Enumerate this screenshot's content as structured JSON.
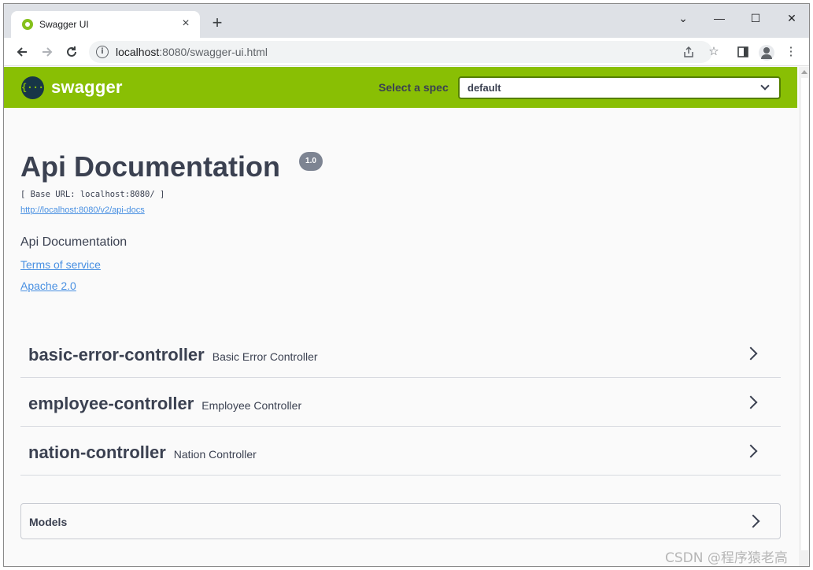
{
  "browser": {
    "tab_title": "Swagger UI",
    "tab_close": "×",
    "new_tab": "+",
    "window_controls": {
      "chevron": "⌄",
      "minimize": "—",
      "maximize": "☐",
      "close": "✕"
    },
    "url_host": "localhost",
    "url_path": ":8080/swagger-ui.html",
    "icons": [
      "back-icon",
      "forward-icon",
      "reload-icon",
      "site-info-icon",
      "share-icon",
      "bookmark-star-icon",
      "side-panel-icon",
      "profile-icon",
      "menu-icon"
    ]
  },
  "topbar": {
    "logo_text": "swagger",
    "logo_mark": "{···}",
    "select_label": "Select a spec",
    "select_value": "default",
    "accent_color": "#89bf04"
  },
  "info": {
    "title": "Api Documentation",
    "version": "1.0",
    "base_url": "[ Base URL: localhost:8080/ ]",
    "api_docs_link": "http://localhost:8080/v2/api-docs",
    "description": "Api Documentation",
    "terms_link": "Terms of service",
    "license_link": "Apache 2.0"
  },
  "controllers": [
    {
      "name": "basic-error-controller",
      "description": "Basic Error Controller"
    },
    {
      "name": "employee-controller",
      "description": "Employee Controller"
    },
    {
      "name": "nation-controller",
      "description": "Nation Controller"
    }
  ],
  "models": {
    "label": "Models"
  },
  "watermark": "CSDN @程序猿老高"
}
